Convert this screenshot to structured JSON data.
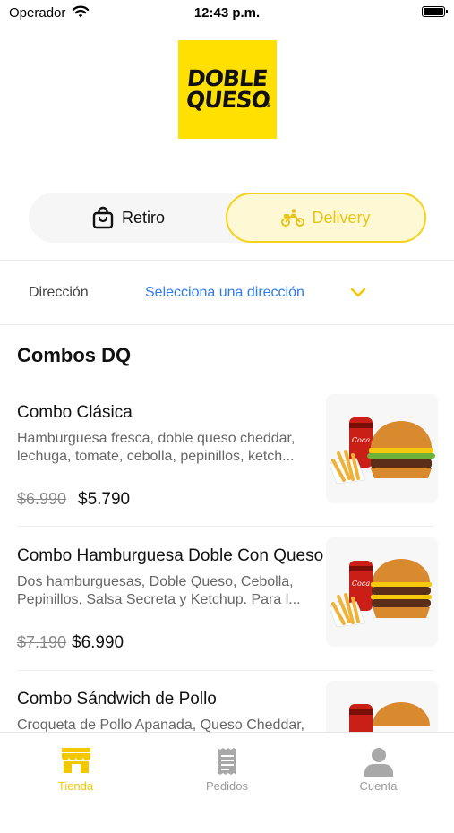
{
  "status_bar": {
    "carrier": "Operador",
    "time": "12:43 p.m."
  },
  "logo": {
    "line1": "DOBLE",
    "line2": "QUESO",
    "reg": "®",
    "color": "#FFE000"
  },
  "order_mode": {
    "options": [
      {
        "label": "Retiro",
        "icon": "shopping-bag-icon",
        "selected": false
      },
      {
        "label": "Delivery",
        "icon": "motorbike-icon",
        "selected": true
      }
    ]
  },
  "address": {
    "label": "Dirección",
    "value": "Selecciona una dirección"
  },
  "section": {
    "title": "Combos DQ"
  },
  "products": [
    {
      "name": "Combo Clásica",
      "desc_line1": "Hamburguesa fresca, doble queso cheddar,",
      "desc_line2": "lechuga, tomate, cebolla, pepinillos, ketch...",
      "old_price": "$6.990",
      "price": "$5.790"
    },
    {
      "name": "Combo Hamburguesa Doble Con Queso",
      "desc_line1": "Dos hamburguesas, Doble Queso, Cebolla,",
      "desc_line2": "Pepinillos, Salsa Secreta y Ketchup. Para l...",
      "old_price": "$7.190",
      "price": "$6.990"
    },
    {
      "name": "Combo Sándwich de Pollo",
      "desc_line1": "Croqueta de Pollo Apanada, Queso Cheddar,",
      "desc_line2": "",
      "old_price": "",
      "price": ""
    }
  ],
  "tabbar": {
    "items": [
      {
        "label": "Tienda",
        "icon": "store-icon",
        "active": true
      },
      {
        "label": "Pedidos",
        "icon": "receipt-icon",
        "active": false
      },
      {
        "label": "Cuenta",
        "icon": "user-icon",
        "active": false
      }
    ]
  },
  "colors": {
    "accent": "#F5D21C",
    "link": "#2E7BEF"
  }
}
